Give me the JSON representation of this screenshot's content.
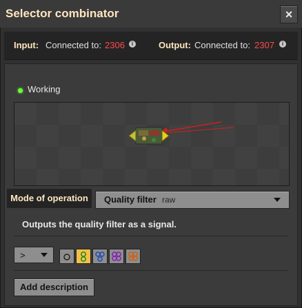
{
  "window": {
    "title": "Selector combinator",
    "close_label": "×"
  },
  "connections": {
    "input": {
      "label": "Input:",
      "text": "Connected to:",
      "network": "2306"
    },
    "output": {
      "label": "Output:",
      "text": "Connected to:",
      "network": "2307"
    }
  },
  "status": {
    "text": "Working",
    "color": "#66ff33"
  },
  "mode": {
    "label": "Mode of operation",
    "selected": "Quality filter",
    "selected_sub": "raw"
  },
  "description": "Outputs the quality filter as a signal.",
  "comparator": {
    "value": ">"
  },
  "quality_buttons": [
    {
      "name": "quality-normal-icon",
      "selected": false
    },
    {
      "name": "quality-uncommon-icon",
      "selected": true
    },
    {
      "name": "quality-rare-icon",
      "selected": false
    },
    {
      "name": "quality-epic-icon",
      "selected": false
    },
    {
      "name": "quality-legendary-icon",
      "selected": false
    }
  ],
  "add_description_label": "Add description",
  "colors": {
    "title": "#ffe6c0",
    "network_red": "#ff4a4a",
    "selected_gold": "#f2c04a"
  }
}
